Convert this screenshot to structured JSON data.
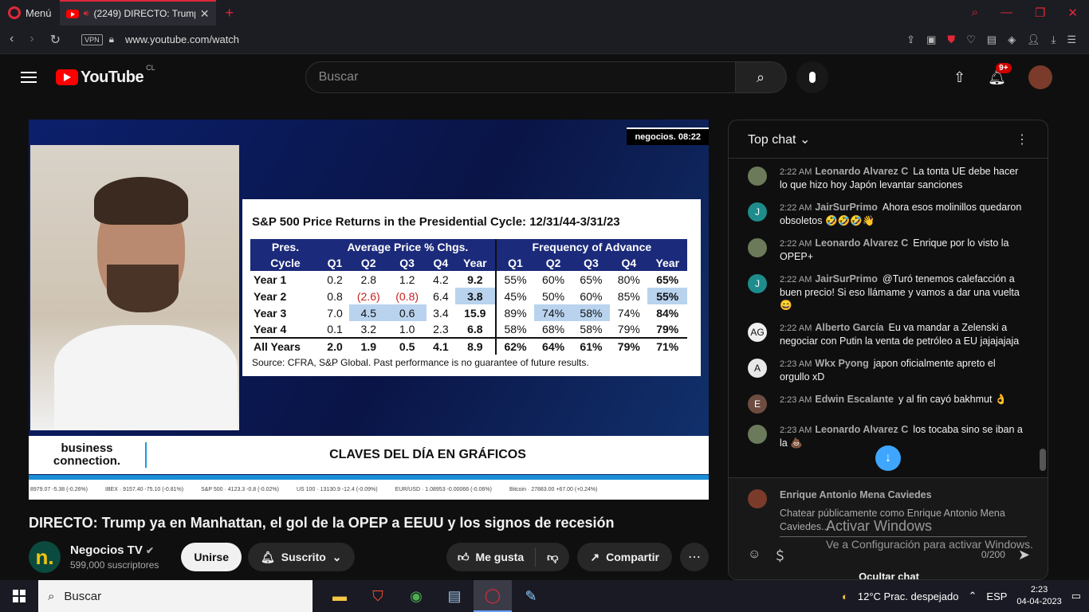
{
  "browser": {
    "menu_label": "Menú",
    "tab_title": "(2249) DIRECTO: Trump",
    "url": "www.youtube.com/watch",
    "vpn_label": "VPN"
  },
  "header": {
    "logo_text": "YouTube",
    "country": "CL",
    "search_placeholder": "Buscar",
    "notification_count": "9+"
  },
  "video": {
    "brand_tag": "negocios. 08:22",
    "chart": {
      "title": "S&P 500 Price Returns in the Presidential Cycle: 12/31/44-3/31/23",
      "group_headers": [
        "Pres.",
        "Average Price % Chgs.",
        "Frequency of Advance"
      ],
      "col_headers": [
        "Cycle",
        "Q1",
        "Q2",
        "Q3",
        "Q4",
        "Year",
        "Q1",
        "Q2",
        "Q3",
        "Q4",
        "Year"
      ],
      "rows": [
        [
          "Year 1",
          "0.2",
          "2.8",
          "1.2",
          "4.2",
          "9.2",
          "55%",
          "60%",
          "65%",
          "80%",
          "65%"
        ],
        [
          "Year 2",
          "0.8",
          "(2.6)",
          "(0.8)",
          "6.4",
          "3.8",
          "45%",
          "50%",
          "60%",
          "85%",
          "55%"
        ],
        [
          "Year 3",
          "7.0",
          "4.5",
          "0.6",
          "3.4",
          "15.9",
          "89%",
          "74%",
          "58%",
          "74%",
          "84%"
        ],
        [
          "Year 4",
          "0.1",
          "3.2",
          "1.0",
          "2.3",
          "6.8",
          "58%",
          "68%",
          "58%",
          "79%",
          "79%"
        ]
      ],
      "total_row": [
        "All Years",
        "2.0",
        "1.9",
        "0.5",
        "4.1",
        "8.9",
        "62%",
        "64%",
        "61%",
        "79%",
        "71%"
      ],
      "source": "Source: CFRA, S&P Global. Past performance is no guarantee of future results."
    },
    "lower_third": {
      "logo_line1": "business",
      "logo_line2": "connection.",
      "title": "CLAVES DEL DÍA EN GRÁFICOS"
    },
    "ticker": [
      "8979.07 -5.38 (-0.26%)",
      "IBEX · 9157.40 -75.10 (-0.81%)",
      "S&P 500 · 4123.3 -0.8 (-0.02%)",
      "US 100 · 13130.9 -12.4 (-0.09%)",
      "EUR/USD · 1.08953 -0.00066 (-0.06%)",
      "Bitcoin · 27883.00 +67.00 (+0.24%)"
    ]
  },
  "below_video": {
    "title": "DIRECTO: Trump ya en Manhattan, el gol de la OPEP a EEUU y los signos de recesión",
    "channel_name": "Negocios TV",
    "subscribers": "599,000 suscriptores",
    "join_label": "Unirse",
    "subscribed_label": "Suscrito",
    "like_label": "Me gusta",
    "share_label": "Compartir"
  },
  "chat": {
    "header": "Top chat",
    "messages": [
      {
        "time": "2:22 AM",
        "author": "Leonardo Alvarez C",
        "text": "La tonta UE debe hacer lo que hizo hoy Japón levantar sanciones",
        "avatar": "",
        "color": "#6b7a5a"
      },
      {
        "time": "2:22 AM",
        "author": "JairSurPrimo",
        "text": "Ahora esos molinillos quedaron obsoletos 🤣🤣🤣👋",
        "avatar": "J",
        "color": "#1e8c8c"
      },
      {
        "time": "2:22 AM",
        "author": "Leonardo Alvarez C",
        "text": "Enrique por lo visto la OPEP+",
        "avatar": "",
        "color": "#6b7a5a"
      },
      {
        "time": "2:22 AM",
        "author": "JairSurPrimo",
        "text": "@Turó tenemos calefacción a buen precio! Si eso llámame y vamos a dar una vuelta 😄",
        "avatar": "J",
        "color": "#1e8c8c"
      },
      {
        "time": "2:22 AM",
        "author": "Alberto García",
        "text": "Eu va mandar a Zelenski a negociar con Putin la venta de petróleo a EU jajajajaja",
        "avatar": "AG",
        "color": "#f0f0f0"
      },
      {
        "time": "2:23 AM",
        "author": "Wkx Pyong",
        "text": "japon oficialmente apreto el orgullo xD",
        "avatar": "A",
        "color": "#e8e8e8"
      },
      {
        "time": "2:23 AM",
        "author": "Edwin Escalante",
        "text": "y al fin cayó bakhmut 👌",
        "avatar": "E",
        "color": "#6d4c41"
      },
      {
        "time": "2:23 AM",
        "author": "Leonardo Alvarez C",
        "text": "los tocaba sino se iban a la 💩",
        "avatar": "",
        "color": "#6b7a5a"
      }
    ],
    "input_name": "Enrique Antonio Mena Caviedes",
    "input_placeholder": "Chatear públicamente como Enrique Antonio Mena Caviedes...",
    "char_count": "0/200",
    "hide_label": "Ocultar chat"
  },
  "watermark": {
    "line1": "Activar Windows",
    "line2": "Ve a Configuración para activar Windows."
  },
  "taskbar": {
    "search_label": "Buscar",
    "weather": "12°C  Prac. despejado",
    "lang": "ESP",
    "time": "2:23",
    "date": "04-04-2023"
  }
}
